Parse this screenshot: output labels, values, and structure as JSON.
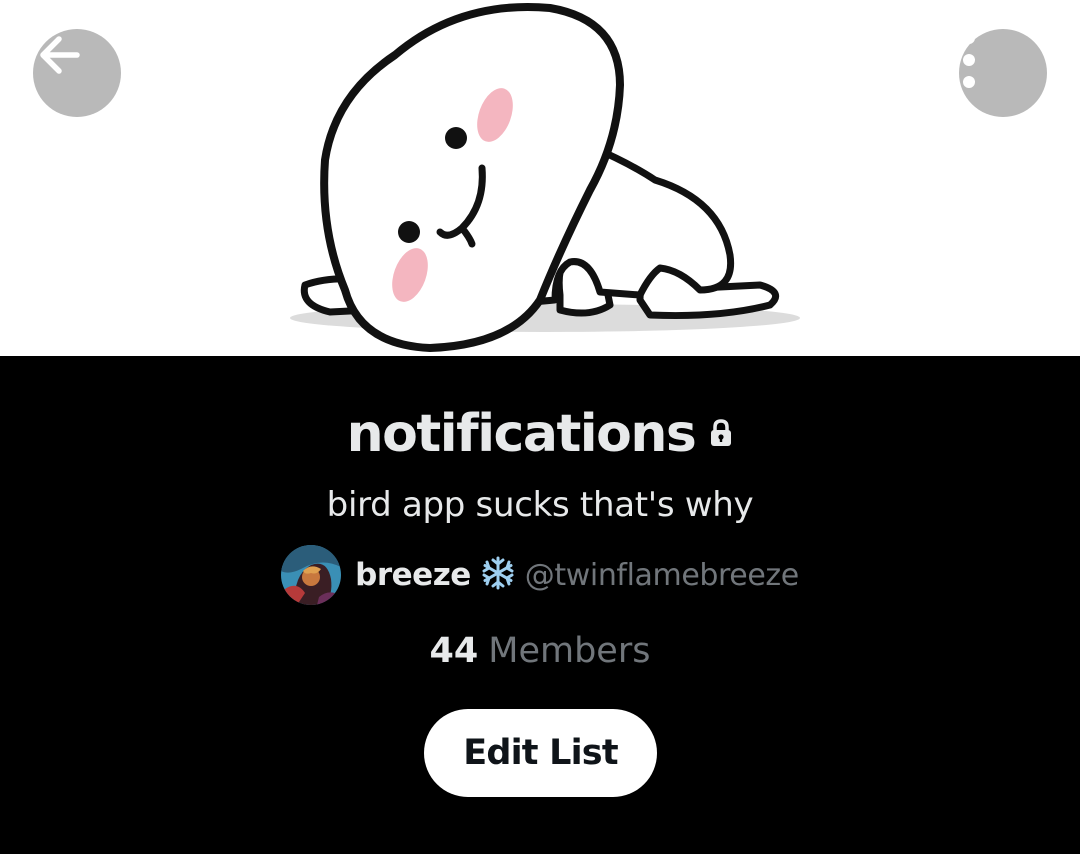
{
  "banner": {
    "image": "cartoon-blob-character-lying-down",
    "background_color": "#ffffff"
  },
  "header": {
    "back_icon": "arrow-left-icon",
    "more_icon": "more-vertical-icon"
  },
  "list": {
    "title": "notifications",
    "private_icon": "lock-icon",
    "description": "bird app sucks that's why"
  },
  "owner": {
    "display_name": "breeze",
    "emoji_icon": "snowflake-icon",
    "handle": "@twinflamebreeze"
  },
  "members": {
    "count": "44",
    "label": "Members"
  },
  "actions": {
    "edit_label": "Edit List"
  },
  "colors": {
    "background": "#000000",
    "primary_text": "#e7e9ea",
    "secondary_text": "#71767b",
    "button_bg": "#ffffff",
    "snowflake": "#9ecff0"
  }
}
